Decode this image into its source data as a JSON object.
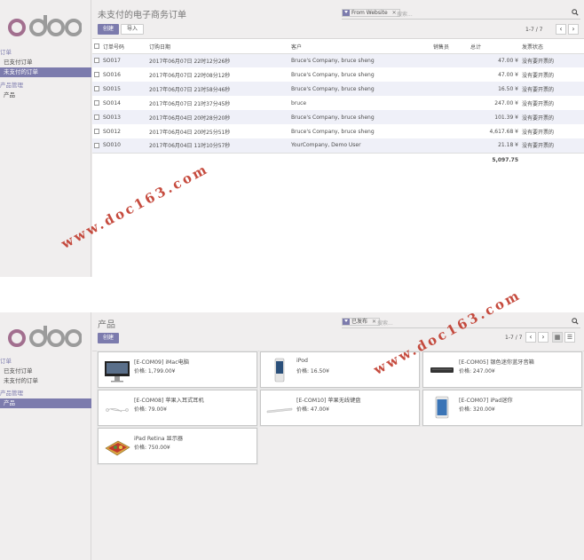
{
  "brand": {
    "logo_text": "odoo",
    "accent": "#7c7bad",
    "watermark_color": "#c0392b"
  },
  "orders_view": {
    "title": "未支付的电子商务订单",
    "create_label": "创建",
    "import_label": "导入",
    "search": {
      "facet": "From Website",
      "placeholder": "搜索..."
    },
    "pager": "1-7 / 7",
    "sidebar": {
      "section1": "订单",
      "item1": "已支付订单",
      "item2": "未支付的订单",
      "section2": "产品管理",
      "item3": "产品"
    },
    "columns": [
      "订单号码",
      "订购日期",
      "客户",
      "销售员",
      "总计",
      "发票状态"
    ],
    "rows": [
      {
        "number": "SO017",
        "date": "2017年06月07日 22时12分26秒",
        "customer": "Bruce's Company, bruce sheng",
        "salesperson": "",
        "total": "47.00 ¥",
        "status": "没有要开票的"
      },
      {
        "number": "SO016",
        "date": "2017年06月07日 22时08分12秒",
        "customer": "Bruce's Company, bruce sheng",
        "salesperson": "",
        "total": "47.00 ¥",
        "status": "没有要开票的"
      },
      {
        "number": "SO015",
        "date": "2017年06月07日 21时58分46秒",
        "customer": "Bruce's Company, bruce sheng",
        "salesperson": "",
        "total": "16.50 ¥",
        "status": "没有要开票的"
      },
      {
        "number": "SO014",
        "date": "2017年06月07日 21时37分45秒",
        "customer": "bruce",
        "salesperson": "",
        "total": "247.00 ¥",
        "status": "没有要开票的"
      },
      {
        "number": "SO013",
        "date": "2017年06月04日 20时28分20秒",
        "customer": "Bruce's Company, bruce sheng",
        "salesperson": "",
        "total": "101.39 ¥",
        "status": "没有要开票的"
      },
      {
        "number": "SO012",
        "date": "2017年06月04日 20时25分51秒",
        "customer": "Bruce's Company, bruce sheng",
        "salesperson": "",
        "total": "4,617.68 ¥",
        "status": "没有要开票的"
      },
      {
        "number": "SO010",
        "date": "2017年06月04日 11时10分57秒",
        "customer": "YourCompany, Demo User",
        "salesperson": "",
        "total": "21.18 ¥",
        "status": "没有要开票的"
      }
    ],
    "sum_total": "5,097.75"
  },
  "products_view": {
    "title": "产品",
    "create_label": "创建",
    "search": {
      "facet": "已发布",
      "placeholder": "搜索..."
    },
    "pager": "1-7 / 7",
    "sidebar": {
      "section1": "订单",
      "item1": "已支付订单",
      "item2": "未支付的订单",
      "section2": "产品管理",
      "item3": "产品"
    },
    "cards": [
      {
        "name": "[E-COM09] iMac电脑",
        "price": "价格: 1,799.00¥",
        "icon": "imac-icon"
      },
      {
        "name": "iPod",
        "price": "价格: 16.50¥",
        "icon": "ipod-icon"
      },
      {
        "name": "[E-COM05] 银色迷你蓝牙音箱",
        "price": "价格: 247.00¥",
        "icon": "speaker-icon"
      },
      {
        "name": "[E-COM08] 苹果入耳式耳机",
        "price": "价格: 79.00¥",
        "icon": "earphones-icon"
      },
      {
        "name": "[E-COM10] 苹果无线键盘",
        "price": "价格: 47.00¥",
        "icon": "keyboard-icon"
      },
      {
        "name": "[E-COM07] iPad迷你",
        "price": "价格: 320.00¥",
        "icon": "ipad-icon"
      },
      {
        "name": "iPad Retina 显示器",
        "price": "价格: 750.00¥",
        "icon": "retina-icon"
      }
    ]
  },
  "watermark": {
    "text1": "www.doc163.com",
    "text2": "www.doc163.com"
  }
}
